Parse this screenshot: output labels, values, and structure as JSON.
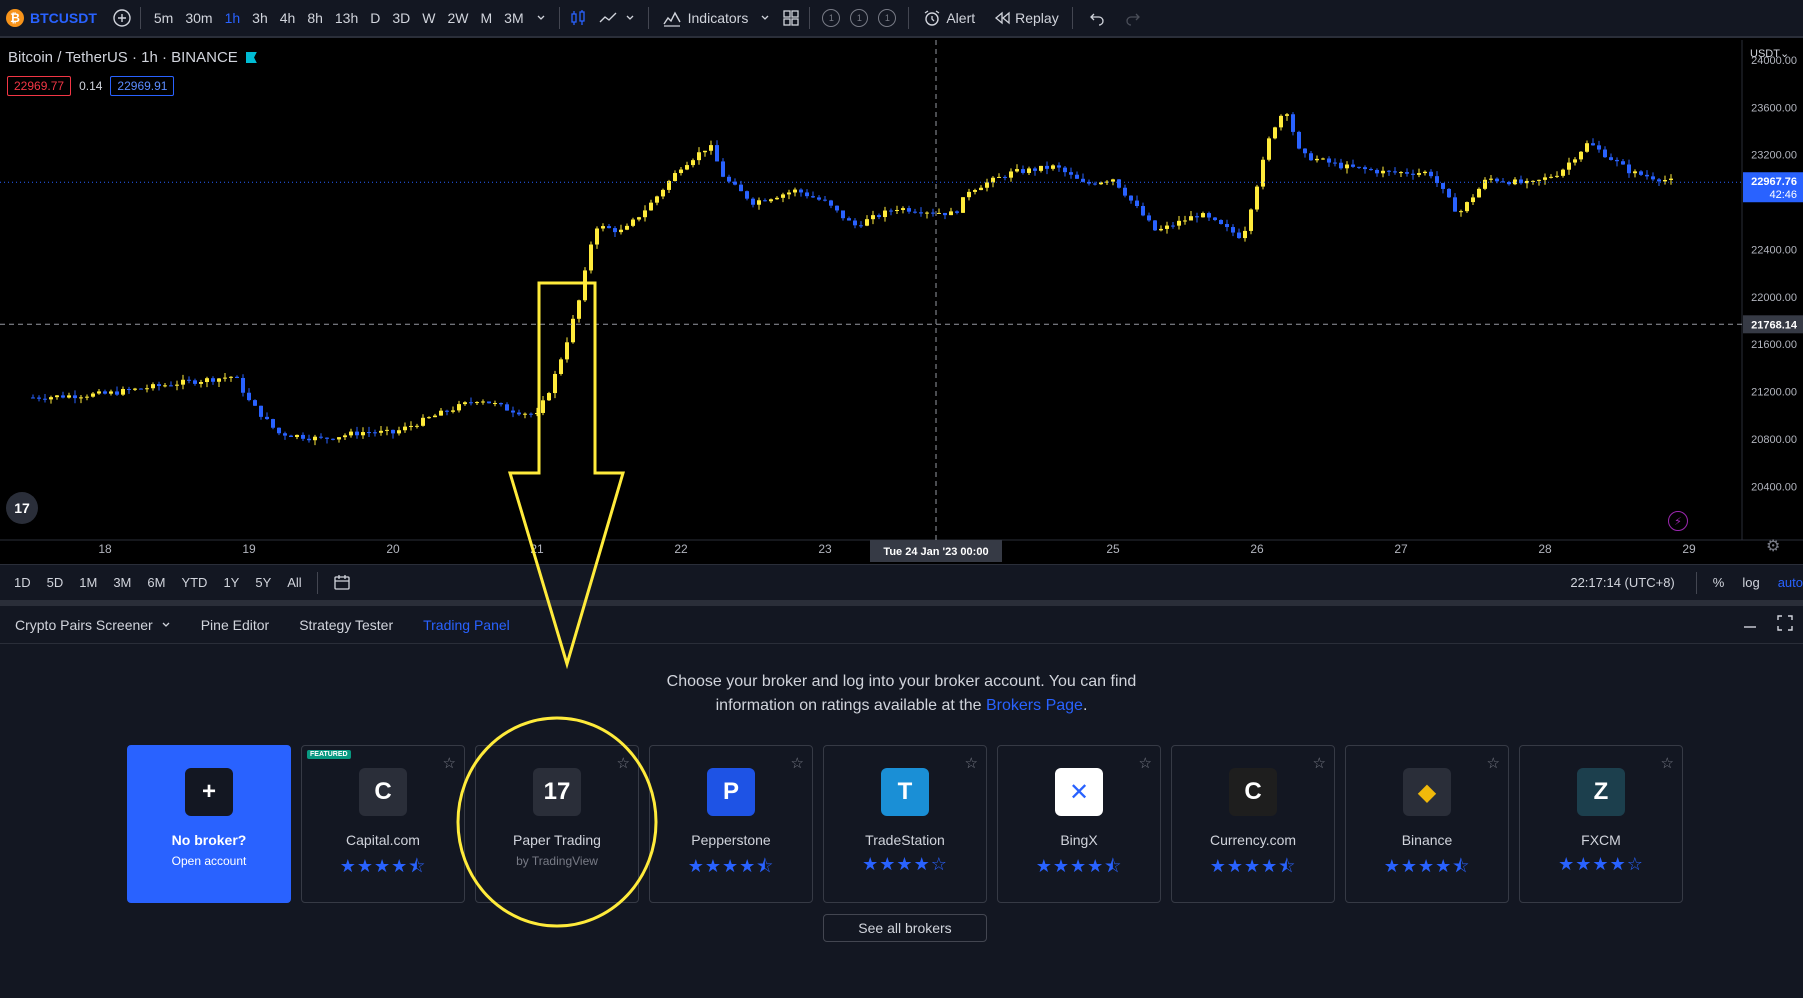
{
  "toolbar": {
    "symbol": "BTCUSDT",
    "coin_glyph": "₿",
    "timeframes": [
      "5m",
      "30m",
      "1h",
      "3h",
      "4h",
      "8h",
      "13h",
      "D",
      "3D",
      "W",
      "2W",
      "M",
      "3M"
    ],
    "active_timeframe": "1h",
    "indicators_label": "Indicators",
    "alert_label": "Alert",
    "replay_label": "Replay"
  },
  "chart": {
    "title": "Bitcoin / TetherUS · 1h · BINANCE",
    "bid_price": "22969.77",
    "spread": "0.14",
    "ask_price": "22969.91",
    "currency": "USDT",
    "last_price": "22967.76",
    "countdown": "42:46",
    "crosshair_price": "21768.14",
    "crosshair_time": "Tue 24 Jan '23   00:00",
    "price_ticks": [
      "24000.00",
      "23600.00",
      "23200.00",
      "22400.00",
      "22000.00",
      "21600.00",
      "21200.00",
      "20800.00",
      "20400.00"
    ],
    "date_ticks": [
      "18",
      "19",
      "20",
      "21",
      "22",
      "23",
      "25",
      "26",
      "27",
      "28",
      "29"
    ],
    "up_color": "#ffeb3b",
    "down_color": "#2962ff",
    "logo_text": "17"
  },
  "chart_data": {
    "type": "candlestick",
    "title": "Bitcoin / TetherUS · 1h · BINANCE",
    "xlabel": "",
    "ylabel": "",
    "ylim": [
      20200,
      24000
    ],
    "x_ticks": [
      "18",
      "19",
      "20",
      "21",
      "22",
      "23",
      "24",
      "25",
      "26",
      "27",
      "28",
      "29"
    ],
    "anchors": [
      [
        17.5,
        21150
      ],
      [
        18.0,
        21180
      ],
      [
        18.5,
        21270
      ],
      [
        18.9,
        21330
      ],
      [
        19.0,
        21120
      ],
      [
        19.2,
        20850
      ],
      [
        19.5,
        20800
      ],
      [
        19.8,
        20860
      ],
      [
        20.0,
        20850
      ],
      [
        20.3,
        21000
      ],
      [
        20.6,
        21140
      ],
      [
        20.8,
        21050
      ],
      [
        21.0,
        21000
      ],
      [
        21.1,
        21250
      ],
      [
        21.2,
        21600
      ],
      [
        21.3,
        22000
      ],
      [
        21.4,
        22600
      ],
      [
        21.6,
        22550
      ],
      [
        21.8,
        22800
      ],
      [
        22.0,
        23100
      ],
      [
        22.2,
        23280
      ],
      [
        22.3,
        23000
      ],
      [
        22.5,
        22800
      ],
      [
        22.8,
        22900
      ],
      [
        23.0,
        22800
      ],
      [
        23.2,
        22600
      ],
      [
        23.5,
        22750
      ],
      [
        23.9,
        22700
      ],
      [
        24.0,
        22900
      ],
      [
        24.3,
        23050
      ],
      [
        24.6,
        23100
      ],
      [
        24.8,
        22950
      ],
      [
        25.0,
        23000
      ],
      [
        25.3,
        22550
      ],
      [
        25.6,
        22700
      ],
      [
        25.9,
        22500
      ],
      [
        26.1,
        23400
      ],
      [
        26.2,
        23600
      ],
      [
        26.3,
        23200
      ],
      [
        26.6,
        23100
      ],
      [
        26.9,
        23050
      ],
      [
        27.2,
        23050
      ],
      [
        27.4,
        22700
      ],
      [
        27.6,
        23000
      ],
      [
        27.9,
        22950
      ],
      [
        28.1,
        23050
      ],
      [
        28.3,
        23300
      ],
      [
        28.6,
        23050
      ],
      [
        28.9,
        22970
      ]
    ]
  },
  "rangebar": {
    "ranges": [
      "1D",
      "5D",
      "1M",
      "3M",
      "6M",
      "YTD",
      "1Y",
      "5Y",
      "All"
    ],
    "time": "22:17:14 (UTC+8)",
    "percent": "%",
    "log": "log",
    "auto": "auto"
  },
  "panel": {
    "tabs": [
      "Crypto Pairs Screener",
      "Pine Editor",
      "Strategy Tester",
      "Trading Panel"
    ],
    "active_tab": "Trading Panel",
    "message_line1": "Choose your broker and log into your broker account. You can find",
    "message_line2_pre": "information on ratings available at the",
    "message_link": "Brokers Page",
    "message_line2_post": ".",
    "see_all": "See all brokers",
    "featured_badge": "FEATURED",
    "no_broker": {
      "title": "No broker?",
      "subtitle": "Open account",
      "glyph": "+"
    },
    "brokers": [
      {
        "name": "Capital.com",
        "stars": "★★★★⯪",
        "glyph": "C",
        "bg": "#2a2e39"
      },
      {
        "name": "Paper Trading",
        "sub": "by TradingView",
        "glyph": "17",
        "bg": "#2a2e39"
      },
      {
        "name": "Pepperstone",
        "stars": "★★★★⯪",
        "glyph": "P",
        "bg": "#1e53e5"
      },
      {
        "name": "TradeStation",
        "stars": "★★★★☆",
        "glyph": "T",
        "bg": "#1a8fd6"
      },
      {
        "name": "BingX",
        "stars": "★★★★⯪",
        "glyph": "✕",
        "bg": "#ffffff"
      },
      {
        "name": "Currency.com",
        "stars": "★★★★⯪",
        "glyph": "C",
        "bg": "#1e1e1e"
      },
      {
        "name": "Binance",
        "stars": "★★★★⯪",
        "glyph": "◆",
        "bg": "#2a2e39"
      },
      {
        "name": "FXCM",
        "stars": "★★★★☆",
        "glyph": "Z",
        "bg": "#1c3f4d"
      }
    ]
  },
  "annotation": {
    "color": "#ffeb3b"
  }
}
